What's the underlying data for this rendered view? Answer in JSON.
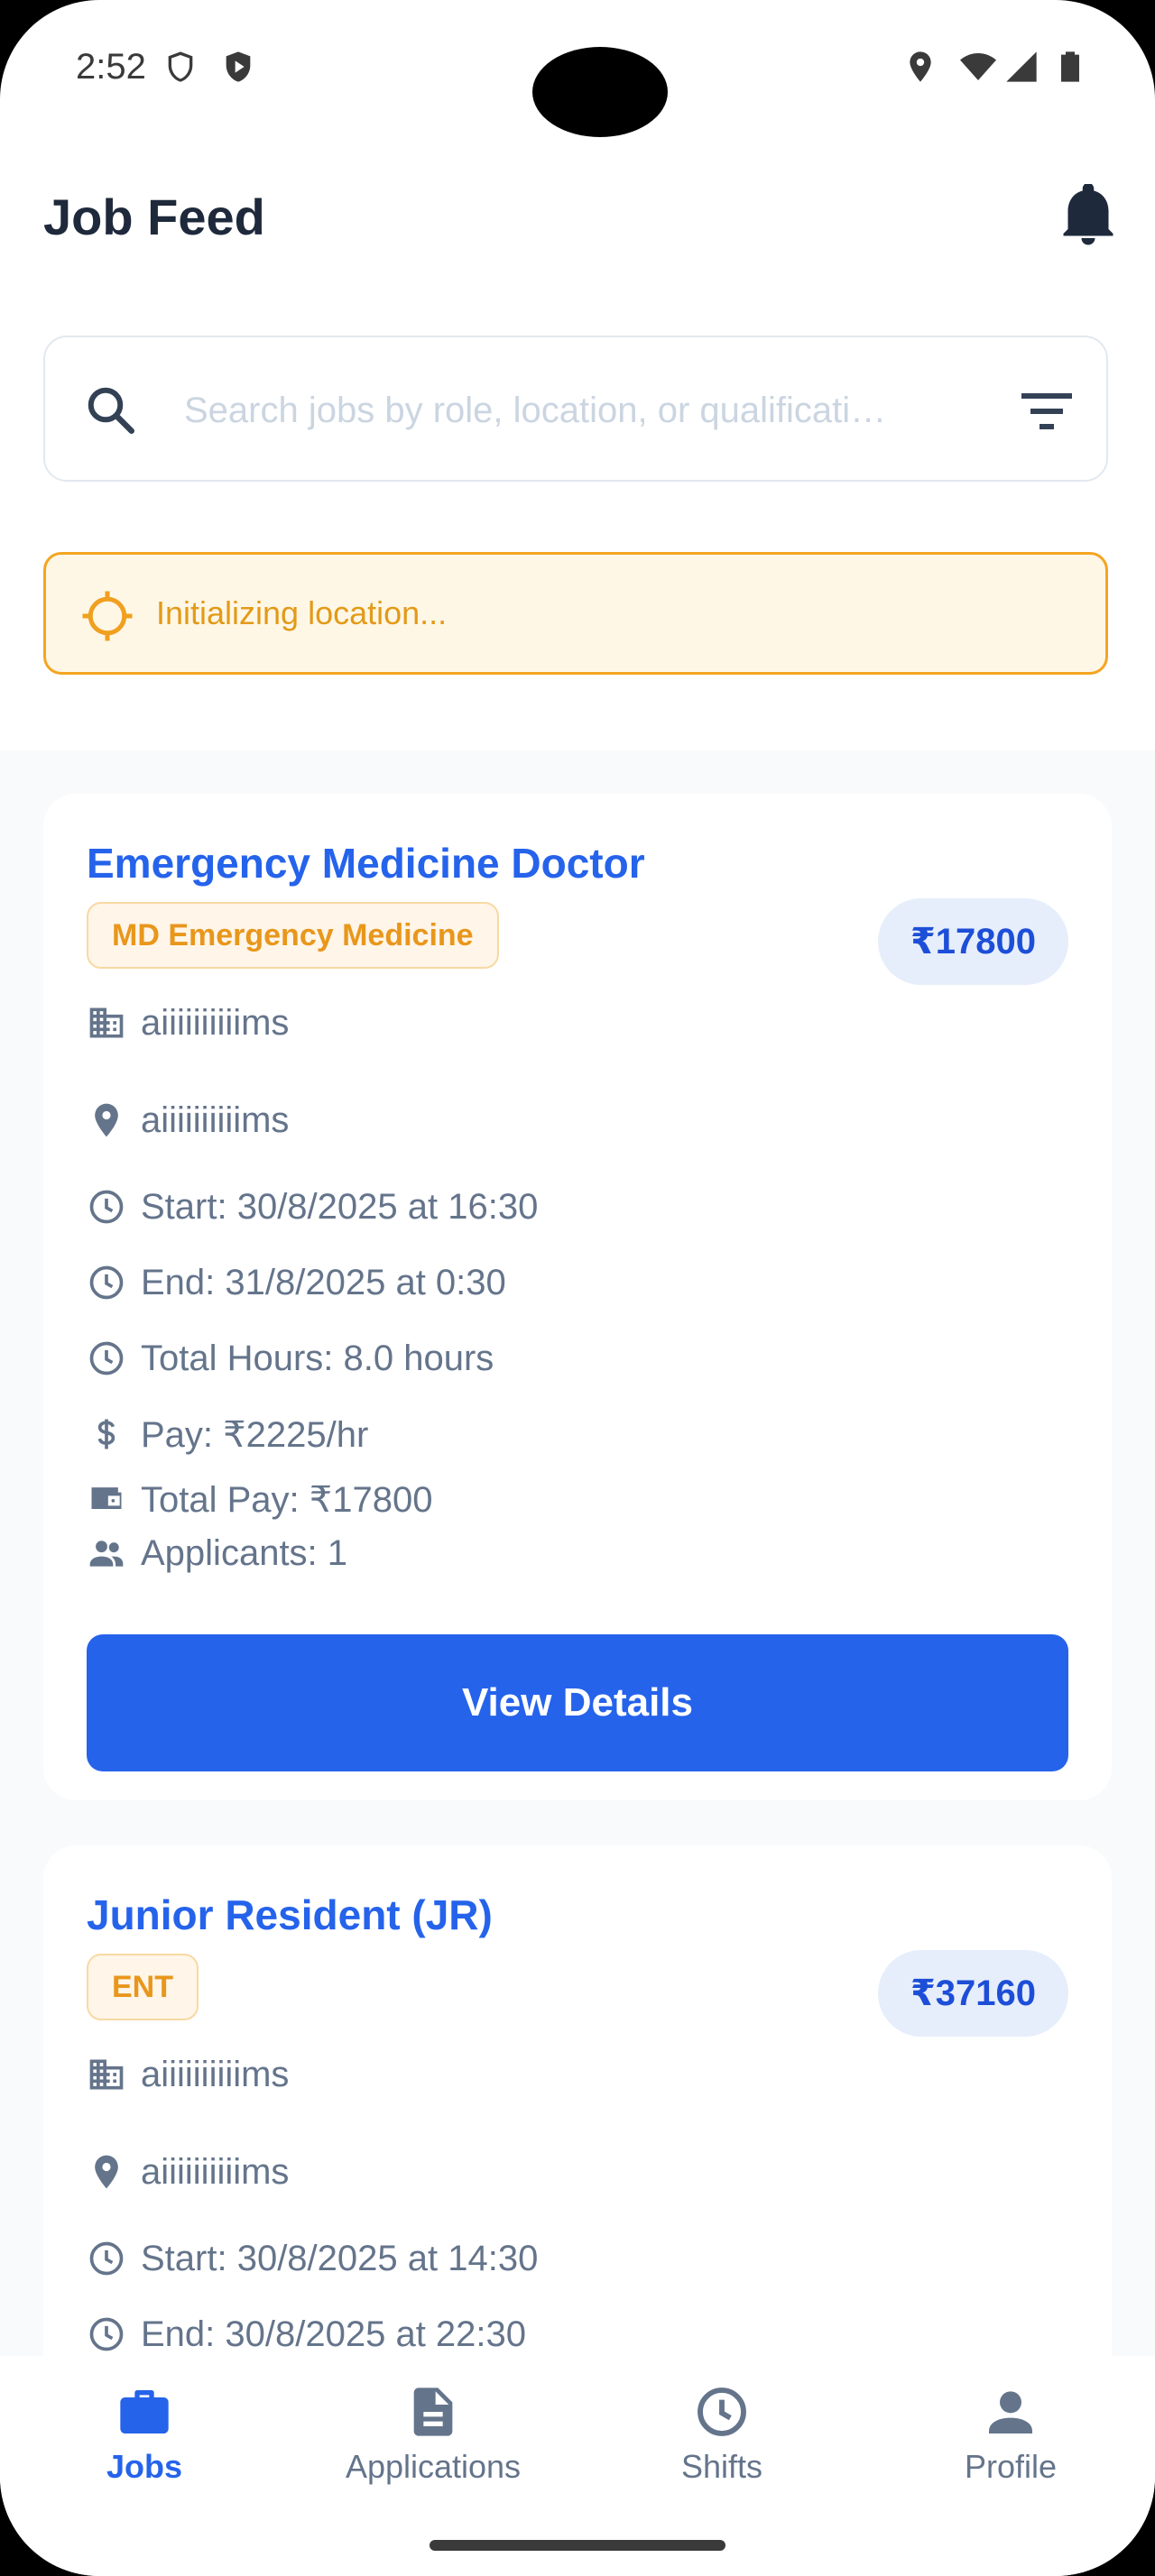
{
  "status_bar": {
    "time": "2:52"
  },
  "header": {
    "title": "Job Feed"
  },
  "search": {
    "placeholder": "Search jobs by role, location, or qualificati…",
    "value": ""
  },
  "location_banner": {
    "text": "Initializing location..."
  },
  "jobs": [
    {
      "title": "Emergency Medicine Doctor",
      "qualification": "MD Emergency Medicine",
      "total_price": "₹17800",
      "hospital": "aiiiiiiiiiims",
      "location": "aiiiiiiiiiims",
      "start": "Start: 30/8/2025 at 16:30",
      "end": "End: 31/8/2025 at 0:30",
      "total_hours": "Total Hours: 8.0 hours",
      "pay": "Pay: ₹2225/hr",
      "total_pay": "Total Pay: ₹17800",
      "applicants": "Applicants: 1",
      "button_label": "View Details"
    },
    {
      "title": "Junior Resident (JR)",
      "qualification": "ENT",
      "total_price": "₹37160",
      "hospital": "aiiiiiiiiiims",
      "location": "aiiiiiiiiiims",
      "start": "Start: 30/8/2025 at 14:30",
      "end": "End: 30/8/2025 at 22:30"
    }
  ],
  "bottom_nav": [
    {
      "label": "Jobs",
      "icon": "briefcase-icon",
      "active": true
    },
    {
      "label": "Applications",
      "icon": "document-icon",
      "active": false
    },
    {
      "label": "Shifts",
      "icon": "clock-icon",
      "active": false
    },
    {
      "label": "Profile",
      "icon": "person-icon",
      "active": false
    }
  ],
  "colors": {
    "accent": "#2563eb",
    "warning": "#f4a522",
    "text_muted": "#64748b"
  }
}
